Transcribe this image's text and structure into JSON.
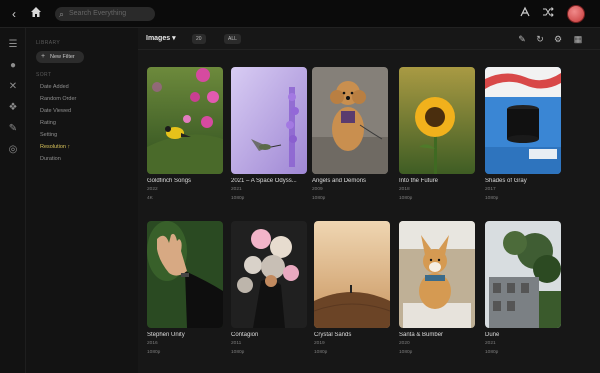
{
  "topbar": {
    "search_placeholder": "Search Everything",
    "icons": [
      "back-icon",
      "home-icon",
      "search-icon",
      "text-format-icon",
      "shuffle-icon",
      "avatar"
    ]
  },
  "sidebar": {
    "section_library": "LIBRARY",
    "new_filter_label": "New Filter",
    "section_sort": "SORT",
    "items": [
      {
        "label": "Date Added",
        "active": false
      },
      {
        "label": "Random Order",
        "active": false
      },
      {
        "label": "Date Viewed",
        "active": false
      },
      {
        "label": "Rating",
        "active": false
      },
      {
        "label": "Setting",
        "active": false
      },
      {
        "label": "Resolution ↑",
        "active": true
      },
      {
        "label": "Duration",
        "active": false
      }
    ]
  },
  "toolbar": {
    "title": "Images",
    "count_pill": "20",
    "sort_pill": "ALL"
  },
  "cards": [
    {
      "title": "Goldfinch Songs",
      "meta": "2022",
      "meta2": "4K",
      "palette": {
        "bg1": "#3d6b2c",
        "bg2": "#a7c46a",
        "accent": "#e6c21a",
        "flower": "#d64aa0"
      }
    },
    {
      "title": "2021 – A Space Odyss...",
      "meta": "2021",
      "meta2": "1080p",
      "palette": {
        "bg1": "#b9a7e2",
        "bg2": "#d9cdf3",
        "accent": "#8a5fcf",
        "flower": "#9b7bd6"
      }
    },
    {
      "title": "Angels and Demons",
      "meta": "2009",
      "meta2": "1080p",
      "palette": {
        "bg1": "#7a766f",
        "bg2": "#9c978f",
        "accent": "#c98f4f",
        "flower": "#5a3b6e"
      }
    },
    {
      "title": "Into the Future",
      "meta": "2018",
      "meta2": "1080p",
      "palette": {
        "bg1": "#4d6a2a",
        "bg2": "#b39b3a",
        "accent": "#f1b11c",
        "flower": "#2f2108"
      }
    },
    {
      "title": "Shades of Gray",
      "meta": "2017",
      "meta2": "1080p",
      "palette": {
        "bg1": "#2b6fb8",
        "bg2": "#4e9be0",
        "accent": "#111111",
        "flower": "#d84848"
      }
    },
    {
      "title": "Stephen Unity",
      "meta": "2016",
      "meta2": "1080p",
      "palette": {
        "bg1": "#1f3b1a",
        "bg2": "#3e6a2d",
        "accent": "#d7a983",
        "flower": "#0d0d0d"
      }
    },
    {
      "title": "Contagion",
      "meta": "2011",
      "meta2": "1080p",
      "palette": {
        "bg1": "#2c2c2c",
        "bg2": "#d9d2c9",
        "accent": "#f2b4c9",
        "flower": "#111111"
      }
    },
    {
      "title": "Crystal Sands",
      "meta": "2019",
      "meta2": "1080p",
      "palette": {
        "bg1": "#e9c9a0",
        "bg2": "#a46b3f",
        "accent": "#6b4426",
        "flower": "#3a2a1a"
      }
    },
    {
      "title": "Santa & Bumber",
      "meta": "2020",
      "meta2": "1080p",
      "palette": {
        "bg1": "#c9b89a",
        "bg2": "#e7e3dc",
        "accent": "#d59a52",
        "flower": "#3a6b8a"
      }
    },
    {
      "title": "Dune",
      "meta": "2021",
      "meta2": "1080p",
      "palette": {
        "bg1": "#d9dde0",
        "bg2": "#3f5d33",
        "accent": "#6b7073",
        "flower": "#2c4a22"
      }
    }
  ]
}
